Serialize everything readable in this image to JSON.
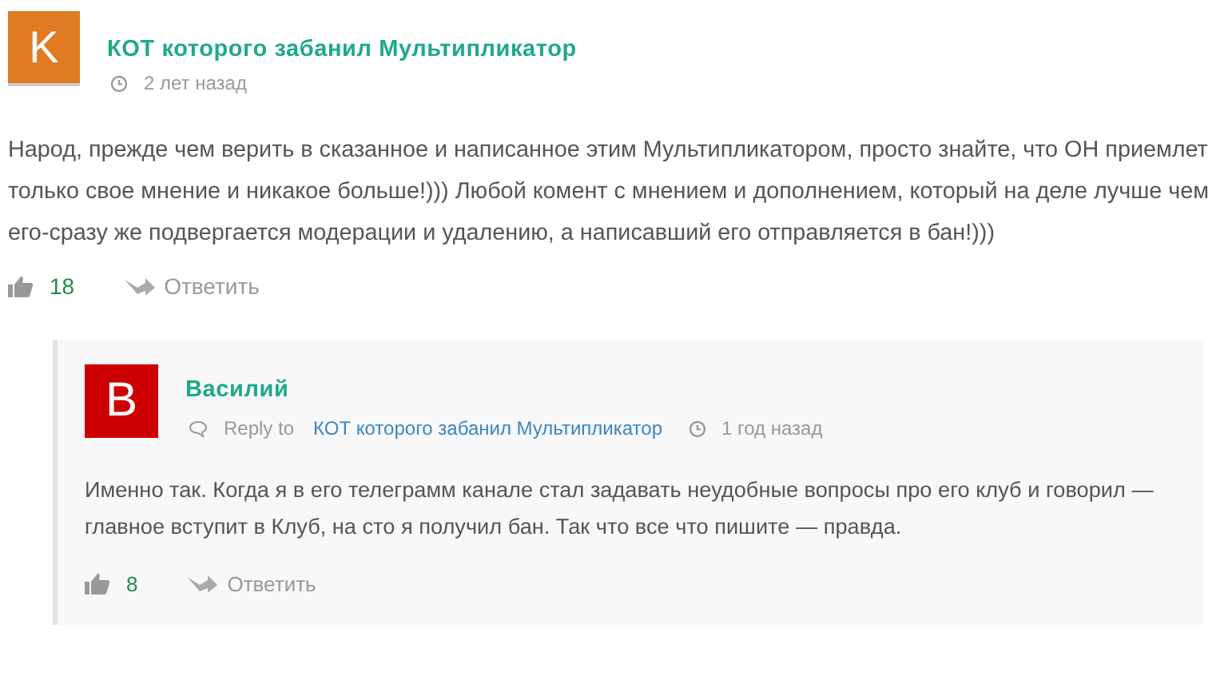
{
  "comments": [
    {
      "avatar_letter": "K",
      "color": "#e07b24",
      "author": "КОТ которого забанил Мультипликатор",
      "time": "2 лет назад",
      "text": "Народ, прежде чем верить в сказанное и написанное этим Мультипликатором, просто знайте, что ОН приемлет только свое мнение и никакое больше!))) Любой комент с мнением и дополнением, который на деле лучше чем его-сразу же подвергается модерации и удалению, а написавший его отправляется в бан!)))",
      "likes": "18",
      "reply": "Ответить",
      "children": [
        {
          "avatar_letter": "В",
          "color": "#cc0000",
          "author": "Василий",
          "reply_to_label": "Reply to",
          "reply_to": "КОТ которого забанил Мультипликатор",
          "time": "1 год назад",
          "text": "Именно так. Когда я в его телеграмм канале стал задавать неудобные вопросы про его клуб и говорил — главное вступит в Клуб, на сто я получил бан. Так что все что пишите — правда.",
          "likes": "8",
          "reply": "Ответить"
        }
      ]
    }
  ]
}
